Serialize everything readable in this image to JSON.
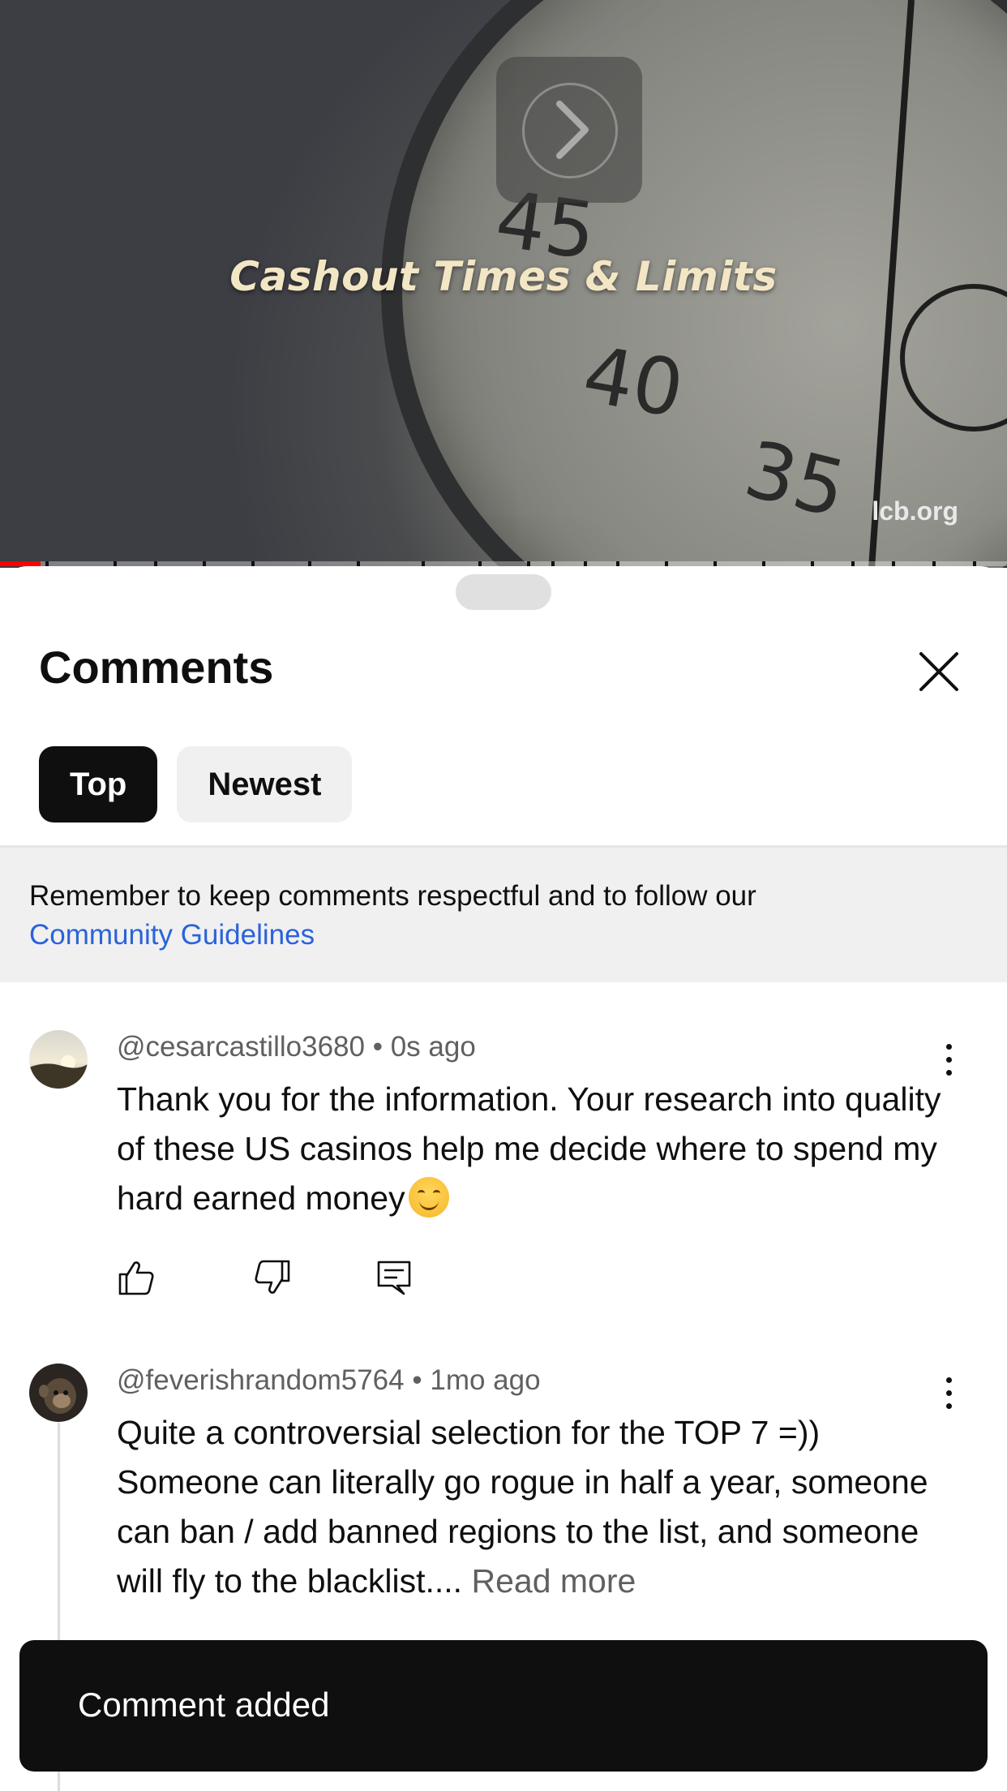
{
  "video": {
    "title": "Cashout Times & Limits",
    "watermark": "lcb.org",
    "dial_numbers": [
      "45",
      "40",
      "35"
    ],
    "progress_fraction": 0.04
  },
  "sheet": {
    "title": "Comments",
    "tabs": [
      {
        "label": "Top",
        "active": true
      },
      {
        "label": "Newest",
        "active": false
      }
    ],
    "notice": {
      "text": "Remember to keep comments respectful and to follow our",
      "link": "Community Guidelines"
    }
  },
  "comments": [
    {
      "author": "@cesarcastillo3680",
      "separator": "•",
      "time": "0s ago",
      "text": "Thank you for the information. Your research into quality of these US casinos help me decide where to spend my hard earned money",
      "emoji": "smiling-face"
    },
    {
      "author": "@feverishrandom5764",
      "separator": "•",
      "time": "1mo ago",
      "text": "Quite a controversial selection for the TOP 7 =)) Someone can literally go rogue in half a year, someone can ban / add banned regions to the list, and someone will fly to the blacklist....",
      "read_more": "Read more"
    }
  ],
  "toast": {
    "text": "Comment added"
  },
  "colors": {
    "progress_played": "#ff0000",
    "link": "#2b63d9",
    "toast_bg": "#0f0f0f"
  }
}
